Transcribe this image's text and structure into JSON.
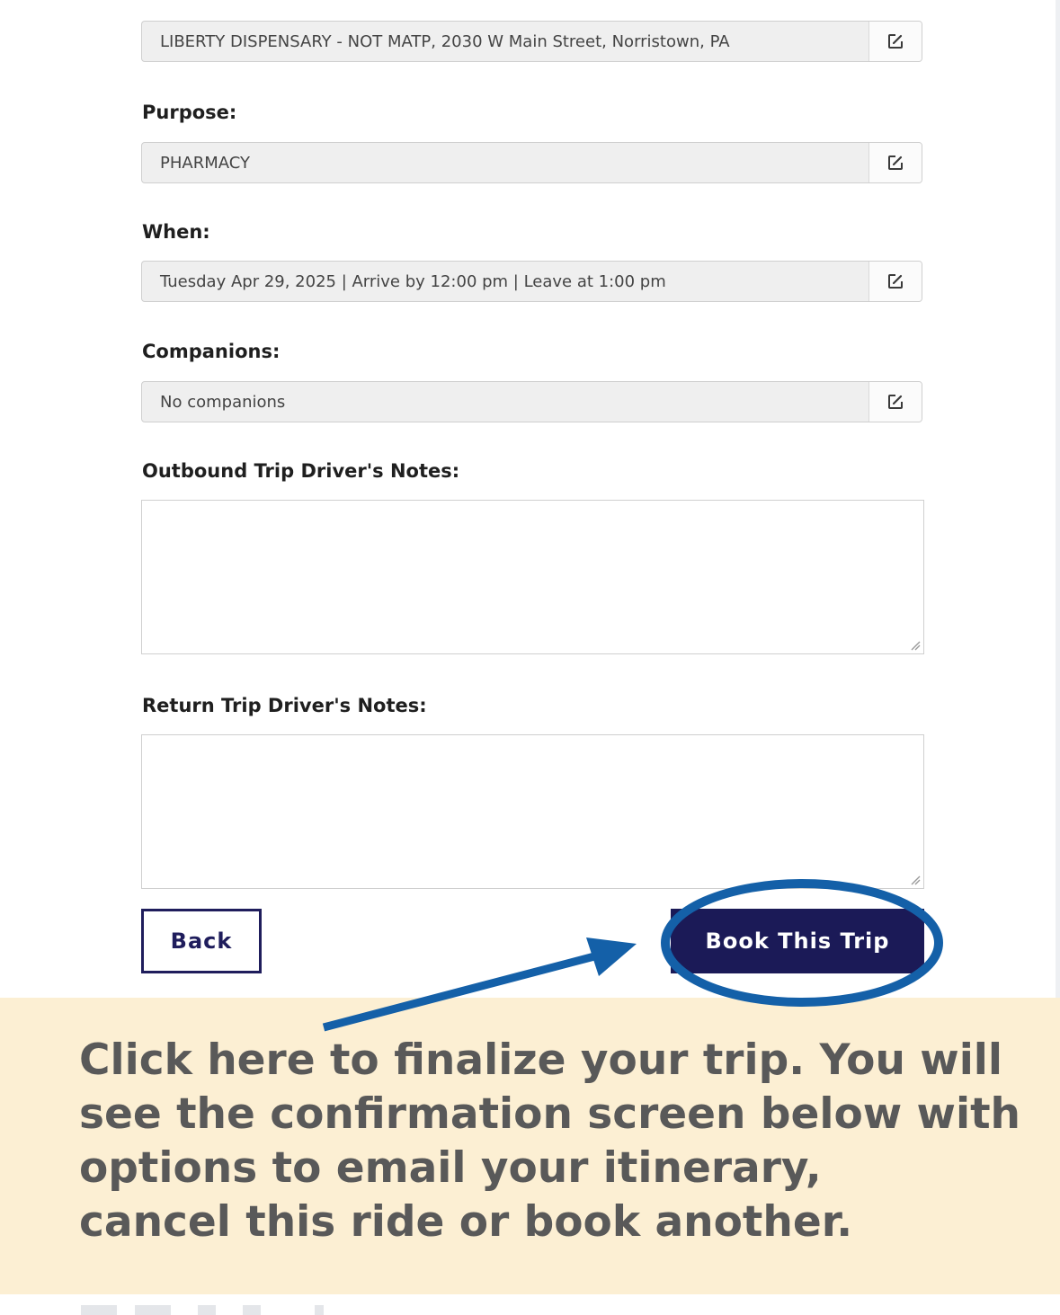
{
  "form": {
    "to": {
      "value": "LIBERTY DISPENSARY - NOT MATP, 2030 W Main Street, Norristown, PA"
    },
    "purpose": {
      "label": "Purpose:",
      "value": "PHARMACY"
    },
    "when": {
      "label": "When:",
      "value": "Tuesday Apr 29, 2025 | Arrive by 12:00 pm | Leave at 1:00 pm"
    },
    "companions": {
      "label": "Companions:",
      "value": "No companions"
    },
    "outbound_notes": {
      "label": "Outbound Trip Driver's Notes:",
      "value": ""
    },
    "return_notes": {
      "label": "Return Trip Driver's Notes:",
      "value": ""
    }
  },
  "buttons": {
    "back": "Back",
    "book": "Book This Trip"
  },
  "callout": {
    "lines": [
      "Click here to finalize your trip. You will",
      "see the confirmation screen below with",
      "options to email your itinerary,",
      "cancel this ride or book another."
    ]
  },
  "colors": {
    "navy_button": "#1b1a57",
    "annotation_blue": "#1460a8",
    "callout_background": "#fcefd3",
    "callout_text": "#595959"
  },
  "icons": {
    "edit": "edit-icon",
    "resize": "resize-grip-icon",
    "arrow": "arrow-annotation",
    "highlight": "circle-highlight"
  }
}
